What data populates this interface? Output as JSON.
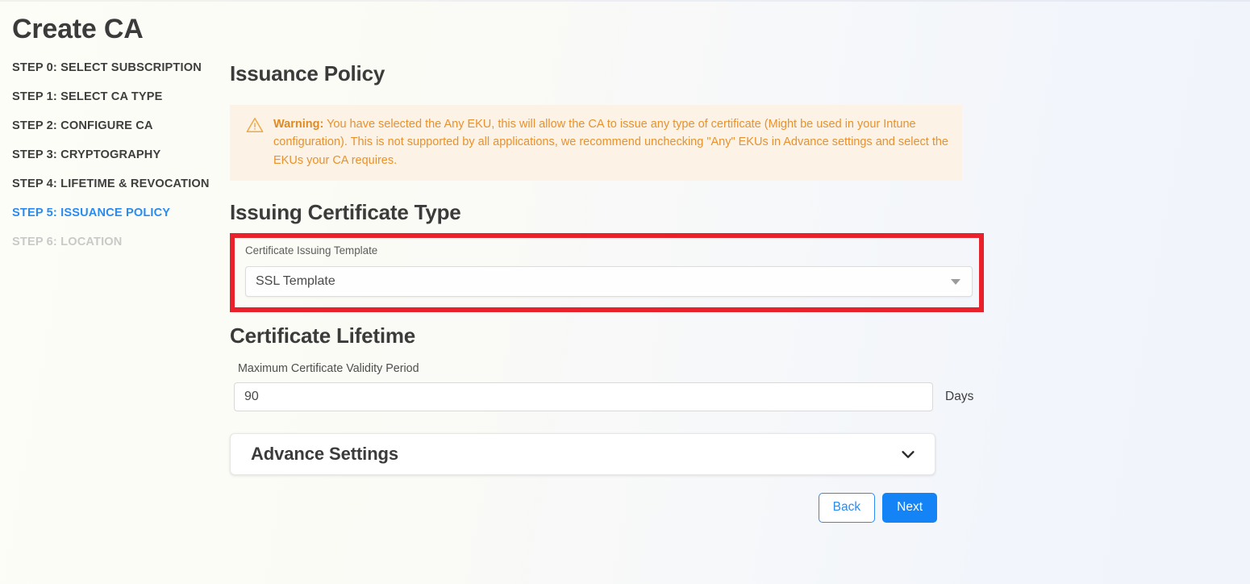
{
  "page": {
    "title": "Create CA"
  },
  "sidebar": {
    "items": [
      {
        "label": "STEP 0: SELECT SUBSCRIPTION",
        "state": "default"
      },
      {
        "label": "STEP 1: SELECT CA TYPE",
        "state": "default"
      },
      {
        "label": "STEP 2: CONFIGURE CA",
        "state": "default"
      },
      {
        "label": "STEP 3: CRYPTOGRAPHY",
        "state": "default"
      },
      {
        "label": "STEP 4: LIFETIME & REVOCATION",
        "state": "default"
      },
      {
        "label": "STEP 5: ISSUANCE POLICY",
        "state": "active"
      },
      {
        "label": "STEP 6: LOCATION",
        "state": "disabled"
      }
    ]
  },
  "main": {
    "heading": "Issuance Policy",
    "warning": {
      "icon": "warning-triangle-icon",
      "label": "Warning:",
      "text": " You have selected the Any EKU, this will allow the CA to issue any type of certificate (Might be used in your Intune configuration). This is not supported by all applications, we recommend unchecking \"Any\" EKUs in Advance settings and select the EKUs your CA requires.",
      "background_color": "#fcf3e6",
      "text_color": "#e8912d"
    },
    "issuing_certificate_type": {
      "heading": "Issuing Certificate Type",
      "field_label": "Certificate Issuing Template",
      "selected_value": "SSL Template",
      "caret_icon": "chevron-down-icon",
      "highlight_color": "#e8212b"
    },
    "certificate_lifetime": {
      "heading": "Certificate Lifetime",
      "field_label": "Maximum Certificate Validity Period",
      "value": "90",
      "placeholder": "90",
      "unit": "Days"
    },
    "advance_settings": {
      "title": "Advance Settings",
      "chevron_icon": "chevron-down-icon",
      "expanded": false
    },
    "buttons": {
      "back": "Back",
      "next": "Next",
      "next_color": "#1383f5",
      "back_color": "#2a8bf2"
    }
  }
}
